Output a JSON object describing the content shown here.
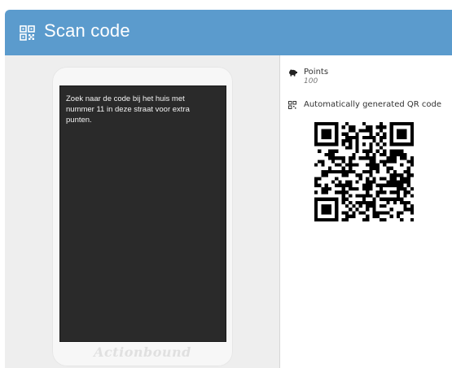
{
  "header": {
    "title": "Scan code",
    "color": "#5b9bcd",
    "icon": "qr-code-icon"
  },
  "phone": {
    "message": "Zoek naar de code bij het huis met nummer 11 in deze straat voor extra punten.",
    "brand": "Actionbound"
  },
  "details": {
    "points_label": "Points",
    "points_value": "100",
    "points_icon": "piggy-bank-icon",
    "qr_label": "Automatically generated QR code",
    "qr_icon": "qr-code-icon"
  }
}
